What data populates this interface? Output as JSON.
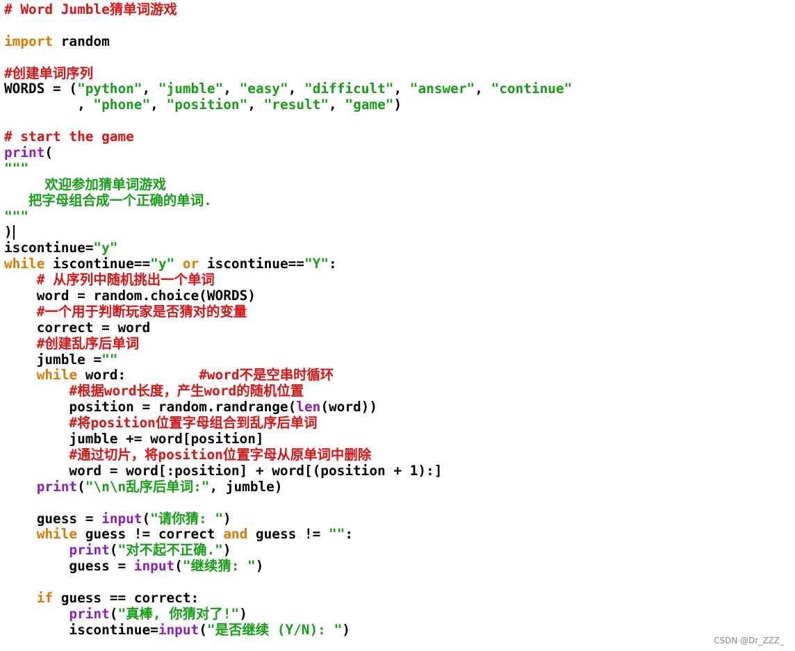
{
  "colors": {
    "default": "#000000",
    "comment": "#e01010",
    "keyword": "#e07800",
    "string": "#14a014",
    "builtin": "#8a1ec0",
    "watermark": "#8a8a8a"
  },
  "editor": {
    "lines": [
      [
        {
          "t": "# Word Jumble猜单词游戏",
          "c": "comment"
        }
      ],
      [],
      [
        {
          "t": "import",
          "c": "keyword"
        },
        {
          "t": " random",
          "c": "default"
        }
      ],
      [],
      [
        {
          "t": "#创建单词序列",
          "c": "comment"
        }
      ],
      [
        {
          "t": "WORDS = (",
          "c": "default"
        },
        {
          "t": "\"python\"",
          "c": "string"
        },
        {
          "t": ", ",
          "c": "default"
        },
        {
          "t": "\"jumble\"",
          "c": "string"
        },
        {
          "t": ", ",
          "c": "default"
        },
        {
          "t": "\"easy\"",
          "c": "string"
        },
        {
          "t": ", ",
          "c": "default"
        },
        {
          "t": "\"difficult\"",
          "c": "string"
        },
        {
          "t": ", ",
          "c": "default"
        },
        {
          "t": "\"answer\"",
          "c": "string"
        },
        {
          "t": ", ",
          "c": "default"
        },
        {
          "t": "\"continue\"",
          "c": "string"
        }
      ],
      [
        {
          "t": "         , ",
          "c": "default"
        },
        {
          "t": "\"phone\"",
          "c": "string"
        },
        {
          "t": ", ",
          "c": "default"
        },
        {
          "t": "\"position\"",
          "c": "string"
        },
        {
          "t": ", ",
          "c": "default"
        },
        {
          "t": "\"result\"",
          "c": "string"
        },
        {
          "t": ", ",
          "c": "default"
        },
        {
          "t": "\"game\"",
          "c": "string"
        },
        {
          "t": ")",
          "c": "default"
        }
      ],
      [],
      [
        {
          "t": "# start the game",
          "c": "comment"
        }
      ],
      [
        {
          "t": "print",
          "c": "builtin"
        },
        {
          "t": "(",
          "c": "default"
        }
      ],
      [
        {
          "t": "\"\"\"",
          "c": "string"
        }
      ],
      [
        {
          "t": "     欢迎参加猜单词游戏",
          "c": "string"
        }
      ],
      [
        {
          "t": "   把字母组合成一个正确的单词.",
          "c": "string"
        }
      ],
      [
        {
          "t": "\"\"\"",
          "c": "string"
        }
      ],
      [
        {
          "t": ")",
          "c": "default"
        },
        {
          "t": "",
          "c": "caret"
        }
      ],
      [
        {
          "t": "iscontinue=",
          "c": "default"
        },
        {
          "t": "\"y\"",
          "c": "string"
        }
      ],
      [
        {
          "t": "while",
          "c": "keyword"
        },
        {
          "t": " iscontinue==",
          "c": "default"
        },
        {
          "t": "\"y\"",
          "c": "string"
        },
        {
          "t": " ",
          "c": "default"
        },
        {
          "t": "or",
          "c": "keyword"
        },
        {
          "t": " iscontinue==",
          "c": "default"
        },
        {
          "t": "\"Y\"",
          "c": "string"
        },
        {
          "t": ":",
          "c": "default"
        }
      ],
      [
        {
          "t": "    # 从序列中随机挑出一个单词",
          "c": "comment"
        }
      ],
      [
        {
          "t": "    word = random.choice(WORDS)",
          "c": "default"
        }
      ],
      [
        {
          "t": "    #一个用于判断玩家是否猜对的变量",
          "c": "comment"
        }
      ],
      [
        {
          "t": "    correct = word",
          "c": "default"
        }
      ],
      [
        {
          "t": "    #创建乱序后单词",
          "c": "comment"
        }
      ],
      [
        {
          "t": "    jumble =",
          "c": "default"
        },
        {
          "t": "\"\"",
          "c": "string"
        }
      ],
      [
        {
          "t": "    ",
          "c": "default"
        },
        {
          "t": "while",
          "c": "keyword"
        },
        {
          "t": " word:         ",
          "c": "default"
        },
        {
          "t": "#word不是空串时循环",
          "c": "comment"
        }
      ],
      [
        {
          "t": "        #根据word长度，产生word的随机位置",
          "c": "comment"
        }
      ],
      [
        {
          "t": "        position = random.randrange(",
          "c": "default"
        },
        {
          "t": "len",
          "c": "builtin"
        },
        {
          "t": "(word))",
          "c": "default"
        }
      ],
      [
        {
          "t": "        #将position位置字母组合到乱序后单词",
          "c": "comment"
        }
      ],
      [
        {
          "t": "        jumble += word[position]",
          "c": "default"
        }
      ],
      [
        {
          "t": "        #通过切片，将position位置字母从原单词中删除",
          "c": "comment"
        }
      ],
      [
        {
          "t": "        word = word[:position] + word[(position + 1):]",
          "c": "default"
        }
      ],
      [
        {
          "t": "    ",
          "c": "default"
        },
        {
          "t": "print",
          "c": "builtin"
        },
        {
          "t": "(",
          "c": "default"
        },
        {
          "t": "\"\\n\\n乱序后单词:\"",
          "c": "string"
        },
        {
          "t": ", jumble)",
          "c": "default"
        }
      ],
      [],
      [
        {
          "t": "    guess = ",
          "c": "default"
        },
        {
          "t": "input",
          "c": "builtin"
        },
        {
          "t": "(",
          "c": "default"
        },
        {
          "t": "\"请你猜: \"",
          "c": "string"
        },
        {
          "t": ")",
          "c": "default"
        }
      ],
      [
        {
          "t": "    ",
          "c": "default"
        },
        {
          "t": "while",
          "c": "keyword"
        },
        {
          "t": " guess != correct ",
          "c": "default"
        },
        {
          "t": "and",
          "c": "keyword"
        },
        {
          "t": " guess != ",
          "c": "default"
        },
        {
          "t": "\"\"",
          "c": "string"
        },
        {
          "t": ":",
          "c": "default"
        }
      ],
      [
        {
          "t": "        ",
          "c": "default"
        },
        {
          "t": "print",
          "c": "builtin"
        },
        {
          "t": "(",
          "c": "default"
        },
        {
          "t": "\"对不起不正确.\"",
          "c": "string"
        },
        {
          "t": ")",
          "c": "default"
        }
      ],
      [
        {
          "t": "        guess = ",
          "c": "default"
        },
        {
          "t": "input",
          "c": "builtin"
        },
        {
          "t": "(",
          "c": "default"
        },
        {
          "t": "\"继续猜: \"",
          "c": "string"
        },
        {
          "t": ")",
          "c": "default"
        }
      ],
      [],
      [
        {
          "t": "    ",
          "c": "default"
        },
        {
          "t": "if",
          "c": "keyword"
        },
        {
          "t": " guess == correct:",
          "c": "default"
        }
      ],
      [
        {
          "t": "        ",
          "c": "default"
        },
        {
          "t": "print",
          "c": "builtin"
        },
        {
          "t": "(",
          "c": "default"
        },
        {
          "t": "\"真棒, 你猜对了!\"",
          "c": "string"
        },
        {
          "t": ")",
          "c": "default"
        }
      ],
      [
        {
          "t": "        iscontinue=",
          "c": "default"
        },
        {
          "t": "input",
          "c": "builtin"
        },
        {
          "t": "(",
          "c": "default"
        },
        {
          "t": "\"是否继续 (Y/N): \"",
          "c": "string"
        },
        {
          "t": ")",
          "c": "default"
        }
      ]
    ]
  },
  "watermark": {
    "text": "CSDN @Dr_ZZZ_"
  }
}
